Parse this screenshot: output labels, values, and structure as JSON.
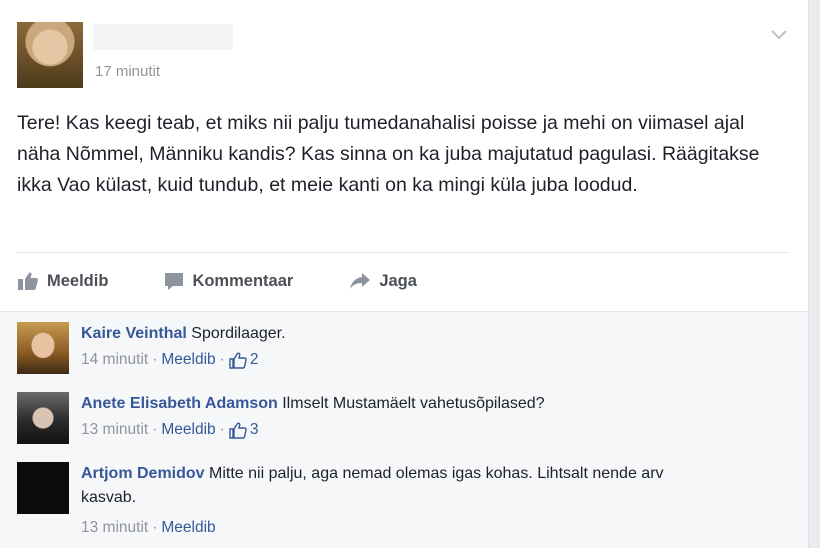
{
  "post": {
    "time": "17 minutit",
    "text": "Tere! Kas keegi teab, et miks nii palju tumedanahalisi poisse ja mehi on viimasel ajal näha Nõmmel, Männiku kandis? Kas sinna on ka juba majutatud pagulasi. Räägitakse ikka Vao külast, kuid tundub, et meie kanti on ka mingi küla juba loodud."
  },
  "actions": {
    "like": "Meeldib",
    "comment": "Kommentaar",
    "share": "Jaga"
  },
  "comments": [
    {
      "name": "Kaire Veinthal",
      "text": "Spordilaager.",
      "time": "14 minutit",
      "like": "Meeldib",
      "likes": "2"
    },
    {
      "name": "Anete Elisabeth Adamson",
      "text": "Ilmselt Mustamäelt vahetusõpilased?",
      "time": "13 minutit",
      "like": "Meeldib",
      "likes": "3"
    },
    {
      "name": "Artjom Demidov",
      "text": "Mitte nii palju, aga nemad olemas igas kohas. Lihtsalt nende arv kasvab.",
      "time": "13 minutit",
      "like": "Meeldib"
    }
  ],
  "meta_separator": "·",
  "colors": {
    "link": "#365899",
    "secondary": "#90949c",
    "background": "#e9ebee"
  }
}
